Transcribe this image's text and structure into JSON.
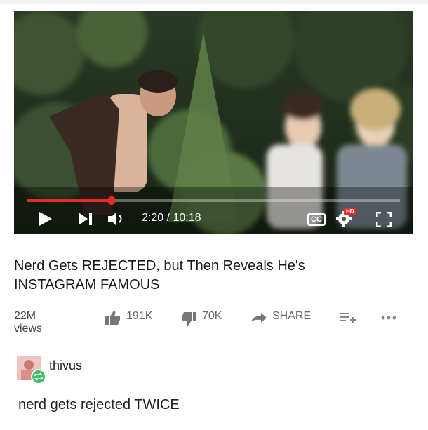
{
  "video": {
    "time_display": "2:20 / 10:18",
    "progress": 0.227,
    "cc_label": "CC",
    "hd_label": "HD"
  },
  "title": {
    "line1": "Nerd Gets REJECTED, but Then Reveals He's",
    "line2": "INSTAGRAM FAMOUS"
  },
  "stats": {
    "views": "22M views",
    "likes": "191K",
    "dislikes": "70K",
    "share_label": "SHARE"
  },
  "post": {
    "author": "thivus",
    "text": "nerd gets rejected TWICE"
  },
  "colors": {
    "accent_red": "#e52d27",
    "reblog_green": "#3fbf6e"
  }
}
